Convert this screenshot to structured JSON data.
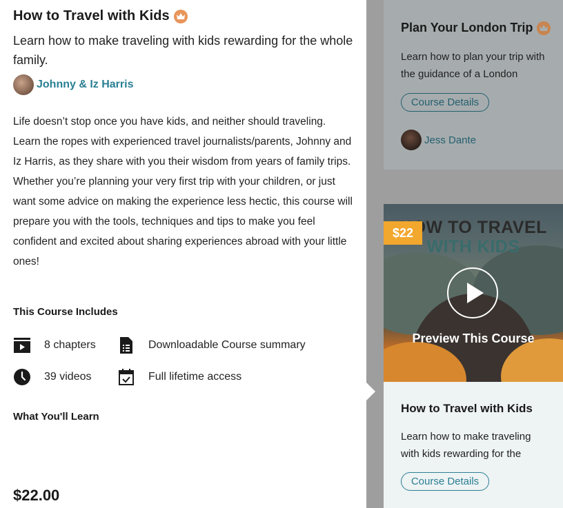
{
  "course": {
    "title": "How to Travel with Kids",
    "subtitle": "Learn how to make traveling with kids rewarding for the whole family.",
    "author": "Johnny & Iz Harris",
    "description": "Life doesn’t stop once you have kids, and neither should traveling. Learn the ropes with experienced travel journalists/parents, Johnny and Iz Harris, as they share with you their wisdom from years of family trips. Whether you’re planning your very first trip with your children, or just want some advice on making the experience less hectic, this course will prepare you with the tools, techniques and tips to make you feel confident and excited about sharing experiences abroad with your little ones!",
    "includes_title": "This Course Includes",
    "includes": {
      "chapters": "8 chapters",
      "summary": "Downloadable Course summary",
      "videos": "39 videos",
      "access": "Full lifetime access"
    },
    "learn_title": "What You'll Learn",
    "price": "$22.00"
  },
  "sidebar": {
    "card1": {
      "title": "Plan Your London Trip",
      "description": "Learn how to plan your trip with the guidance of a London",
      "button": "Course Details",
      "author": "Jess Dante"
    },
    "card2": {
      "price_tag": "$22",
      "banner_line1": "HOW TO TRAVEL",
      "banner_line2": "WITH KIDS",
      "preview_label": "Preview This Course",
      "title": "How to Travel with Kids",
      "description": "Learn how to make traveling with kids rewarding for the",
      "button": "Course Details"
    }
  },
  "colors": {
    "accent": "#2a7f93",
    "crown": "#e8955a",
    "price_tag": "#f2a72d"
  }
}
